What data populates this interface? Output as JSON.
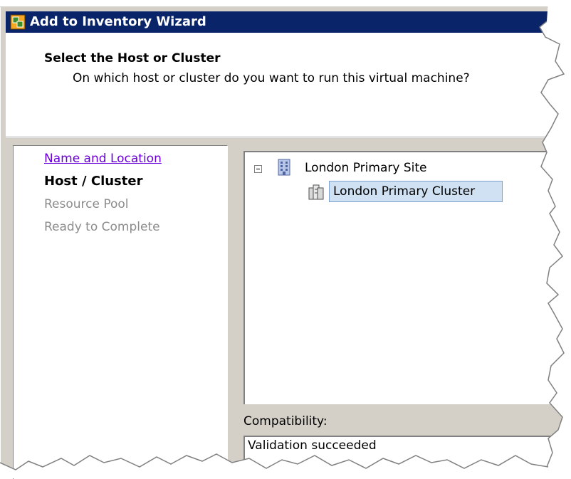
{
  "window": {
    "title": "Add to Inventory Wizard",
    "icon": "vmware-app-icon"
  },
  "header": {
    "title": "Select the Host or Cluster",
    "subtitle": "On which host or cluster do you want to run this virtual machine?"
  },
  "steps": [
    {
      "label": "Name and Location",
      "state": "completed-link"
    },
    {
      "label": "Host / Cluster",
      "state": "current"
    },
    {
      "label": "Resource Pool",
      "state": "pending"
    },
    {
      "label": "Ready to Complete",
      "state": "pending"
    }
  ],
  "tree": {
    "datacenter": {
      "label": "London Primary Site",
      "icon": "datacenter-icon",
      "expanded": true
    },
    "cluster": {
      "label": "London Primary Cluster",
      "icon": "cluster-icon",
      "selected": true
    }
  },
  "compatibility": {
    "label": "Compatibility:",
    "value": "Validation succeeded"
  },
  "colors": {
    "titlebar": "#0a246a",
    "dialog_face": "#d4d0c8",
    "link": "#6a00d8",
    "selection": "#cfe1f3"
  }
}
